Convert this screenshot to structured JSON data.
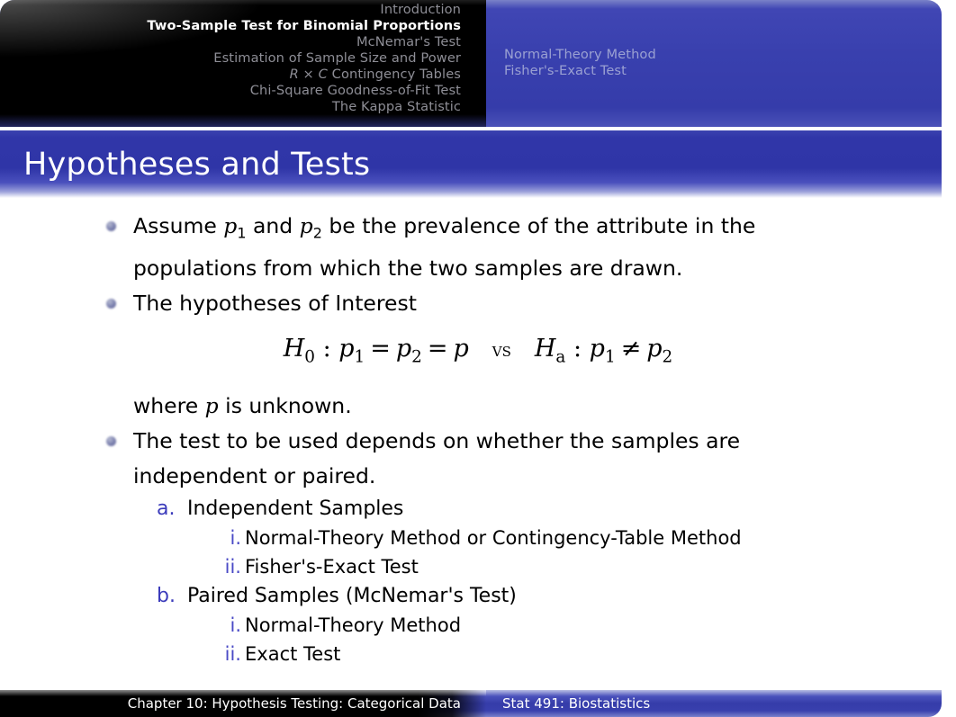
{
  "nav": {
    "sections": [
      {
        "label": "Introduction",
        "active": false
      },
      {
        "label": "Two-Sample Test for Binomial Proportions",
        "active": true
      },
      {
        "label": "McNemar's Test",
        "active": false
      },
      {
        "label": "Estimation of Sample Size and Power",
        "active": false
      },
      {
        "label": "R × C Contingency Tables",
        "active": false,
        "italic_prefix": "R × C",
        "rest": " Contingency Tables"
      },
      {
        "label": "Chi-Square Goodness-of-Fit Test",
        "active": false
      },
      {
        "label": "The Kappa Statistic",
        "active": false
      }
    ],
    "subsections": [
      {
        "label": "Normal-Theory Method"
      },
      {
        "label": "Fisher's-Exact Test"
      }
    ]
  },
  "title": "Hypotheses and Tests",
  "body": {
    "bullet1_part1": "Assume ",
    "bullet1_p1": "p",
    "bullet1_p1_sub": "1",
    "bullet1_part2": " and ",
    "bullet1_p2": "p",
    "bullet1_p2_sub": "2",
    "bullet1_part3": " be the prevalence of the attribute in the populations from which the two samples are drawn.",
    "bullet2": "The hypotheses of Interest",
    "equation": {
      "h0": "H",
      "h0_sub": "0",
      "colon1": " : ",
      "p1": "p",
      "p1_sub": "1",
      "eq1": "=",
      "p2": "p",
      "p2_sub": "2",
      "eq2": "=",
      "p": "p",
      "vs": "vs",
      "ha": "H",
      "ha_sub": "a",
      "colon2": " : ",
      "p1b": "p",
      "p1b_sub": "1",
      "neq": "≠",
      "p2b": "p",
      "p2b_sub": "2",
      "plain": "H0 : p1 = p2 = p   vs   Ha : p1 ≠ p2"
    },
    "where_part1": "where ",
    "where_p": "p",
    "where_part2": " is unknown.",
    "bullet3": "The test to be used depends on whether the samples are independent or paired.",
    "enumerate": [
      {
        "marker": "a.",
        "label": "Independent Samples",
        "sub": [
          {
            "marker": "i.",
            "label": "Normal-Theory Method or Contingency-Table Method"
          },
          {
            "marker": "ii.",
            "label": "Fisher's-Exact Test"
          }
        ]
      },
      {
        "marker": "b.",
        "label": "Paired Samples (McNemar's Test)",
        "sub": [
          {
            "marker": "i.",
            "label": "Normal-Theory Method"
          },
          {
            "marker": "ii.",
            "label": "Exact Test"
          }
        ]
      }
    ]
  },
  "footer": {
    "left": "Chapter 10: Hypothesis Testing: Categorical Data",
    "right": "Stat 491: Biostatistics"
  },
  "colors": {
    "header_blue": "#353caa",
    "header_black": "#000000",
    "title_blue": "#2f35a7",
    "enum_marker_blue": "#3b3bbb",
    "nav_inactive": "#8e8e96",
    "nav_active": "#ffffff",
    "subsection_text": "#9aa0d2"
  }
}
